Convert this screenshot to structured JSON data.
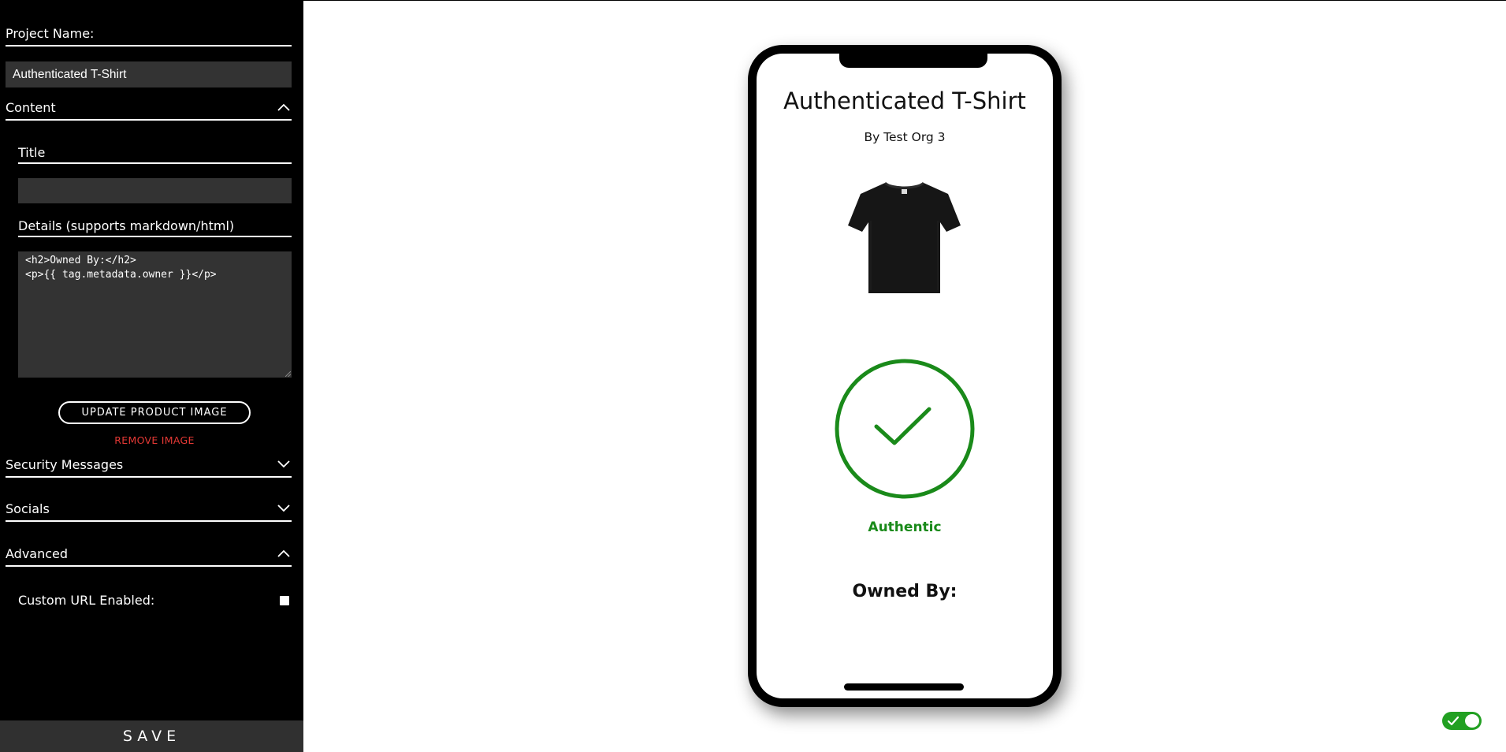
{
  "sidebar": {
    "project_name_label": "Project Name:",
    "project_name_value": "Authenticated T-Shirt",
    "content": {
      "label": "Content",
      "expanded": true,
      "title_label": "Title",
      "title_value": "",
      "details_label": "Details (supports markdown/html)",
      "details_value": "<h2>Owned By:</h2>\n<p>{{ tag.metadata.owner }}</p>",
      "update_image_label": "UPDATE PRODUCT IMAGE",
      "remove_image_label": "REMOVE IMAGE"
    },
    "security_messages": {
      "label": "Security Messages",
      "expanded": false
    },
    "socials": {
      "label": "Socials",
      "expanded": false
    },
    "advanced": {
      "label": "Advanced",
      "expanded": true,
      "custom_url_label": "Custom URL Enabled:",
      "custom_url_enabled": false
    },
    "save_label": "SAVE"
  },
  "preview": {
    "title": "Authenticated T-Shirt",
    "org": "By Test Org 3",
    "product_image": "black-tshirt",
    "status": "Authentic",
    "details_heading": "Owned By:"
  },
  "toggle": {
    "on": true
  },
  "colors": {
    "sidebar_bg": "#000000",
    "input_bg": "#333333",
    "remove_red": "#e53935",
    "authentic_green": "#1a8a1a",
    "toggle_green": "#22a022"
  }
}
